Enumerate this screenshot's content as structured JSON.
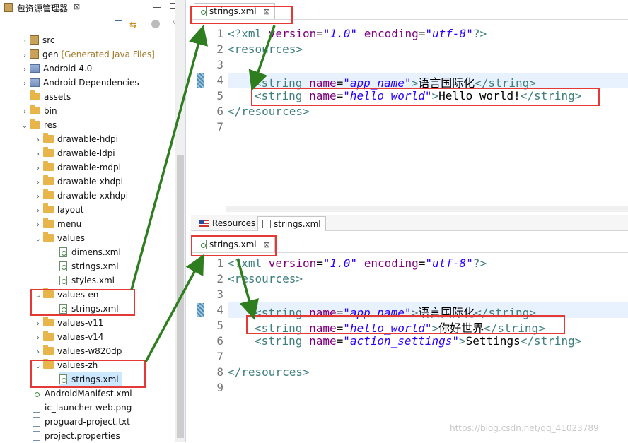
{
  "explorer": {
    "title": "包资源管理器",
    "close": "⊠",
    "toolbar": [
      "collapse-all-icon",
      "link-editor-icon",
      "view-menu-icon"
    ],
    "rows": [
      {
        "label": "src"
      },
      {
        "label": "gen",
        "deco": "[Generated Java Files]"
      },
      {
        "label": "Android 4.0"
      },
      {
        "label": "Android Dependencies"
      },
      {
        "label": "assets"
      },
      {
        "label": "bin"
      },
      {
        "label": "res"
      },
      {
        "label": "drawable-hdpi"
      },
      {
        "label": "drawable-ldpi"
      },
      {
        "label": "drawable-mdpi"
      },
      {
        "label": "drawable-xhdpi"
      },
      {
        "label": "drawable-xxhdpi"
      },
      {
        "label": "layout"
      },
      {
        "label": "menu"
      },
      {
        "label": "values"
      },
      {
        "label": "dimens.xml"
      },
      {
        "label": "strings.xml"
      },
      {
        "label": "styles.xml"
      },
      {
        "label": "values-en"
      },
      {
        "label": "strings.xml"
      },
      {
        "label": "values-v11"
      },
      {
        "label": "values-v14"
      },
      {
        "label": "values-w820dp"
      },
      {
        "label": "values-zh"
      },
      {
        "label": "strings.xml"
      },
      {
        "label": "AndroidManifest.xml"
      },
      {
        "label": "ic_launcher-web.png"
      },
      {
        "label": "proguard-project.txt"
      },
      {
        "label": "project.properties"
      }
    ]
  },
  "editor_top": {
    "tab": "strings.xml",
    "close": "⊠",
    "line_numbers": [
      "1",
      "2",
      "3",
      "4",
      "5",
      "6",
      "7"
    ],
    "lines": {
      "l1": {
        "a": "<?xml ",
        "b": "version",
        "c": "=",
        "d": "\"1.0\"",
        "e": " ",
        "f": "encoding",
        "g": "=",
        "h": "\"utf-8\"",
        "i": "?>"
      },
      "l2": "<resources>",
      "l4": {
        "open": "<string ",
        "attr": "name",
        "eq": "=",
        "val": "\"app_name\"",
        "close": ">",
        "text": "语言国际化",
        "end": "</string>"
      },
      "l5": {
        "open": "<string ",
        "attr": "name",
        "eq": "=",
        "val": "\"hello_world\"",
        "close": ">",
        "text": "Hello world!",
        "end": "</string>"
      },
      "l6": "</resources>"
    }
  },
  "bottom_tabs": {
    "resources": "Resources",
    "source": "strings.xml"
  },
  "editor_bottom": {
    "tab": "strings.xml",
    "close": "⊠",
    "line_numbers": [
      "1",
      "2",
      "3",
      "4",
      "5",
      "6",
      "7",
      "8",
      "9"
    ],
    "lines": {
      "l1": {
        "a": "<?xml ",
        "b": "version",
        "c": "=",
        "d": "\"1.0\"",
        "e": " ",
        "f": "encoding",
        "g": "=",
        "h": "\"utf-8\"",
        "i": "?>"
      },
      "l2": "<resources>",
      "l4": {
        "open": "<string ",
        "attr": "name",
        "eq": "=",
        "val": "\"app_name\"",
        "close": ">",
        "text": "语言国际化",
        "end": "</string>"
      },
      "l5": {
        "open": "<string ",
        "attr": "name",
        "eq": "=",
        "val": "\"hello_world\"",
        "close": ">",
        "text": "你好世界",
        "end": "</string>"
      },
      "l6": {
        "open": "<string ",
        "attr": "name",
        "eq": "=",
        "val": "\"action_settings\"",
        "close": ">",
        "text": "Settings",
        "end": "</string>"
      },
      "l8": "</resources>"
    }
  },
  "watermark": "https://blog.csdn.net/qq_41023789",
  "colors": {
    "annotation_red": "#e53935",
    "arrow_green": "#2e7d1f",
    "tag": "#3f7f7f",
    "attr": "#7f007f",
    "value": "#2a00ff"
  }
}
